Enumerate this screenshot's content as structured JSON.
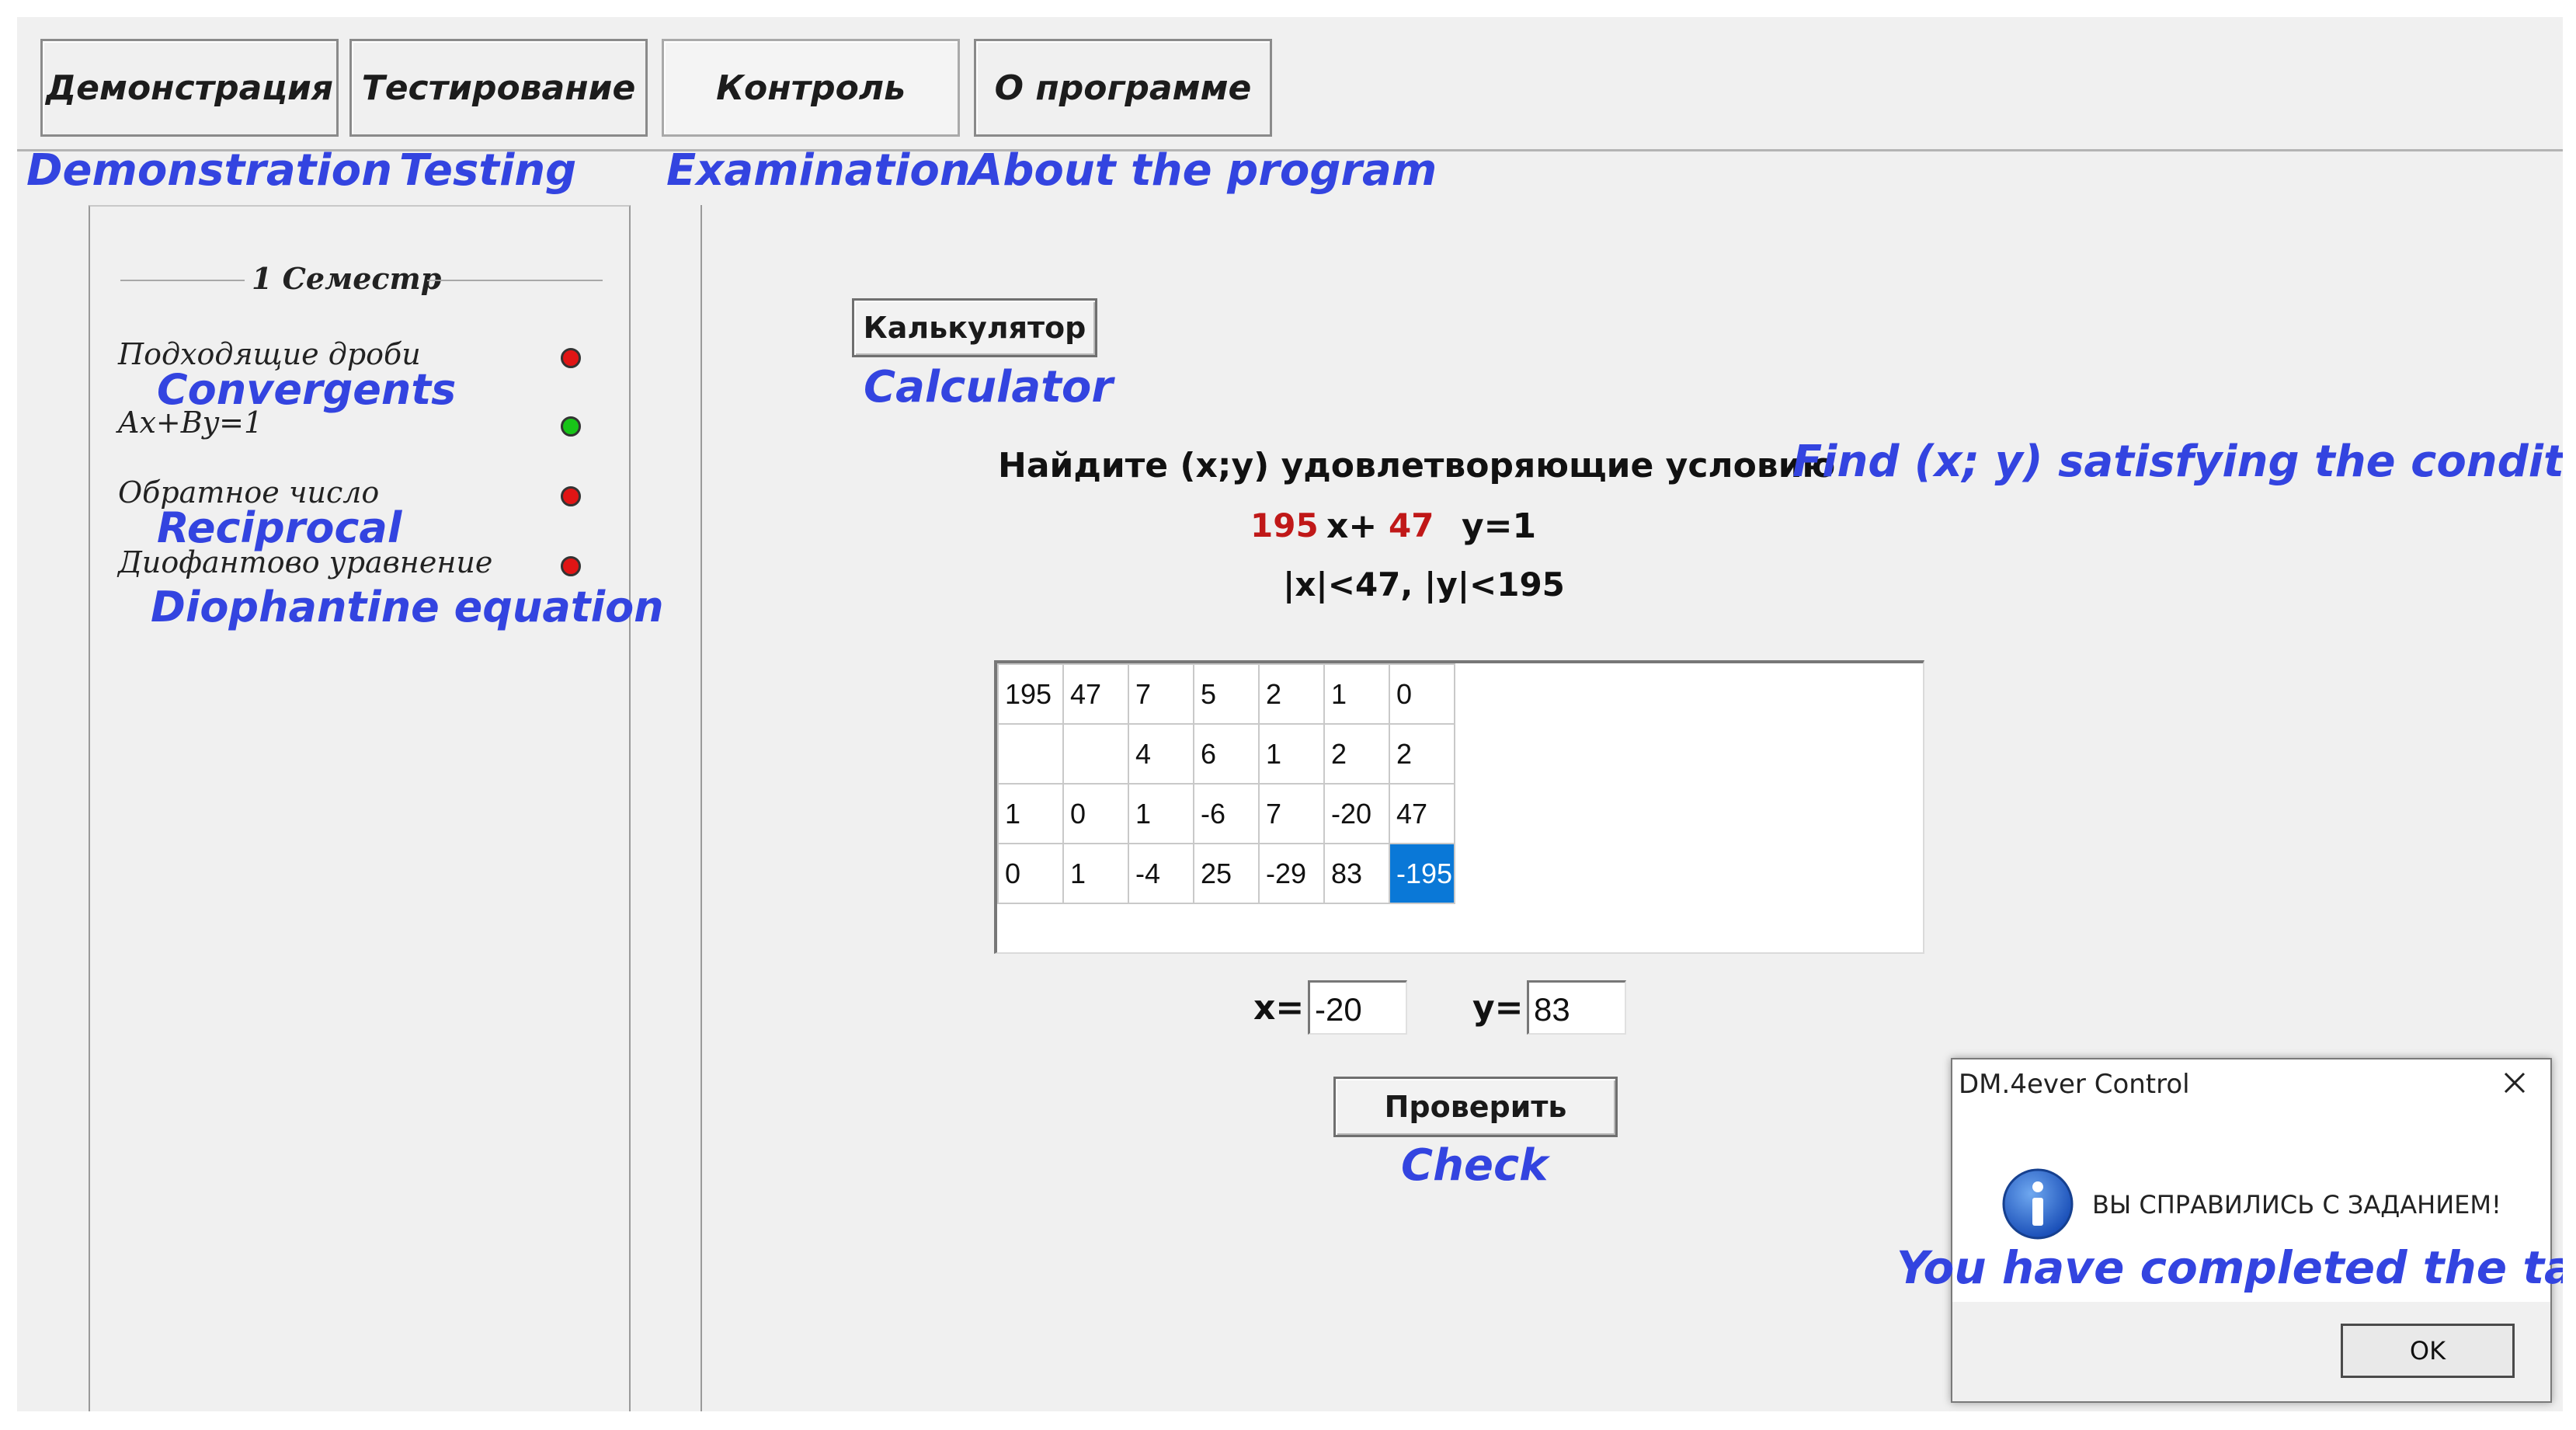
{
  "tabs": [
    {
      "label": "Демонстрация",
      "translation": "Demonstration"
    },
    {
      "label": "Тестирование",
      "translation": "Testing"
    },
    {
      "label": "Контроль",
      "translation": "Examination",
      "active": true
    },
    {
      "label": "О программе",
      "translation": "About the program"
    }
  ],
  "sidebar": {
    "group_title": "1 Семестр",
    "items": [
      {
        "label": "Подходящие дроби",
        "translation": "Convergents",
        "status": "red"
      },
      {
        "label": "Ax+By=1",
        "translation": "",
        "status": "green"
      },
      {
        "label": "Обратное число",
        "translation": "Reciprocal",
        "status": "red"
      },
      {
        "label": "Диофантово уравнение",
        "translation": "Diophantine equation",
        "status": "red"
      }
    ]
  },
  "calculator": {
    "label": "Калькулятор",
    "translation": "Calculator"
  },
  "task": {
    "prompt": "Найдите (x;y) удовлетворяющие условию",
    "prompt_translation": "Find (x; y) satisfying the condition",
    "coef_a": "195",
    "x_part": "x+",
    "coef_b": "47",
    "y_part": "y=1",
    "constraint": "|x|<47, |y|<195"
  },
  "grid": {
    "rows": [
      [
        "195",
        "47",
        "7",
        "5",
        "2",
        "1",
        "0"
      ],
      [
        "",
        "",
        "4",
        "6",
        "1",
        "2",
        "2"
      ],
      [
        "1",
        "0",
        "1",
        "-6",
        "7",
        "-20",
        "47"
      ],
      [
        "0",
        "1",
        "-4",
        "25",
        "-29",
        "83",
        "-195"
      ]
    ],
    "selected_cell": {
      "row": 3,
      "col": 6
    }
  },
  "answer": {
    "x_label": "x=",
    "x_value": "-20",
    "y_label": "y=",
    "y_value": "83"
  },
  "check": {
    "label": "Проверить",
    "translation": "Check"
  },
  "dialog": {
    "title": "DM.4ever Control",
    "message": "ВЫ СПРАВИЛИСЬ С ЗАДАНИЕМ!",
    "message_translation": "You have completed the task!",
    "ok_label": "OK"
  },
  "colors": {
    "annotation": "#3344e0",
    "coef": "#c01818",
    "selected": "#0a78d7",
    "dot_red": "#e01515",
    "dot_green": "#18c418"
  },
  "icons": {
    "info": "info-icon",
    "close": "close-icon"
  }
}
